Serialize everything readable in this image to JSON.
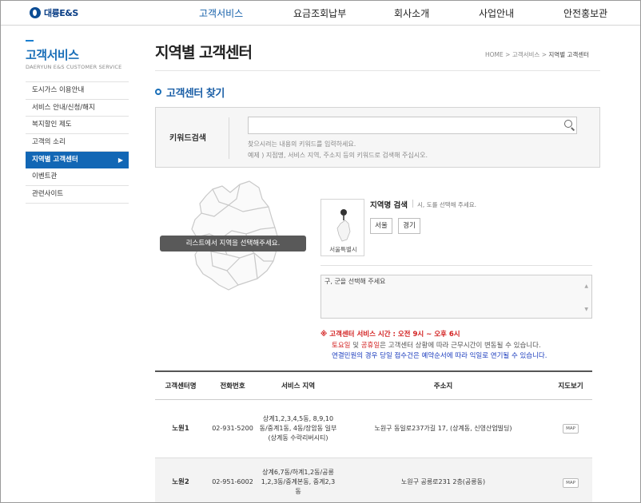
{
  "header": {
    "logo_text": "대륭E&S",
    "nav": [
      "고객서비스",
      "요금조회납부",
      "회사소개",
      "사업안내",
      "안전홍보관"
    ]
  },
  "sidebar": {
    "title": "고객서비스",
    "subtitle": "DAERYUN E&S  CUSTOMER SERVICE",
    "items": [
      {
        "label": "도시가스 이용안내"
      },
      {
        "label": "서비스 안내/신청/해지"
      },
      {
        "label": "복지할인 제도"
      },
      {
        "label": "고객의 소리"
      },
      {
        "label": "지역별 고객센터",
        "active": true
      },
      {
        "label": "이벤트관"
      },
      {
        "label": "관련사이트"
      }
    ]
  },
  "page": {
    "title": "지역별 고객센터",
    "breadcrumb": [
      "HOME",
      "고객서비스",
      "지역별 고객센터"
    ],
    "section_title": "고객센터 찾기"
  },
  "keyword_search": {
    "label": "키워드검색",
    "input_value": "",
    "help_line1": "찾으시려는 내용의 키워드를 입력하세요.",
    "help_line2": "예제 ) 지점명, 서비스 지역, 주소지 등의 키워드로 검색해 주십시오."
  },
  "map": {
    "tooltip": "리스트에서 지역을 선택해주세요."
  },
  "region_search": {
    "thumb_label": "서울특별시",
    "title": "지역명 검색",
    "hint": "시, 도를 선택해 주세요.",
    "buttons": [
      "서울",
      "경기"
    ],
    "district_placeholder": "구, 군을 선택해 주세요"
  },
  "notice": {
    "hours": "※ 고객센터 서비스 시간 : 오전 9시 ~ 오후 6시",
    "weekend_red1": "토요일",
    "weekend_mid": " 및 ",
    "weekend_red2": "공휴일",
    "weekend_rest": "은 고객센터 상황에 따라 근무시간이 변동될 수 있습니다.",
    "delay": "연결민원의 경우 당일 접수건은 예약순서에 따라 익일로 연기될 수 있습니다."
  },
  "table": {
    "headers": [
      "고객센터명",
      "전화번호",
      "서비스 지역",
      "주소지",
      "지도보기"
    ],
    "rows": [
      {
        "name": "노원1",
        "phone": "02-931-5200",
        "area": "상계1,2,3,4,5동, 8,9,10동/중계1동, 4동/장암동 일부(상계동 수락리버시티)",
        "address": "노원구 동일로237가길 17, (상계동, 신영산업빌딩)",
        "map": "MAP"
      },
      {
        "name": "노원2",
        "phone": "02-951-6002",
        "area": "상계6,7동/하계1,2동/공릉1,2,3동/중계본동, 중계2,3동",
        "address": "노원구 공릉로231 2층(공릉동)",
        "map": "MAP"
      }
    ]
  },
  "colors": {
    "brand": "#1267b5",
    "notice_red": "#d21e1e",
    "notice_blue": "#1a3bbd"
  }
}
